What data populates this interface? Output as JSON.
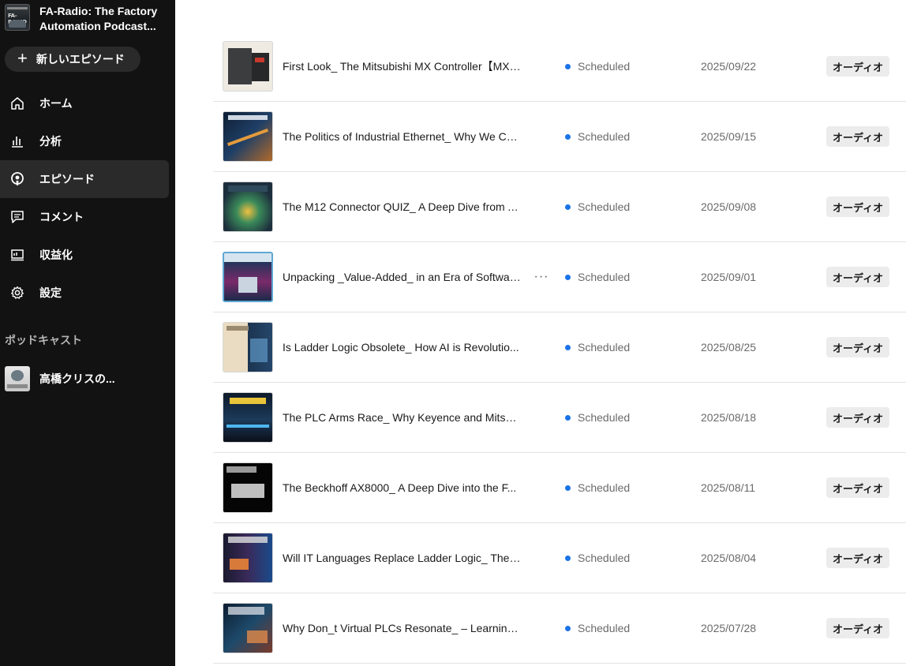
{
  "sidebar": {
    "podcast_title": "FA-Radio: The Factory Automation Podcast...",
    "podcast_thumb_text": "FA-RADIO",
    "new_episode_label": "新しいエピソード",
    "nav": [
      {
        "label": "ホーム",
        "icon": "home-icon"
      },
      {
        "label": "分析",
        "icon": "bar-chart-icon"
      },
      {
        "label": "エピソード",
        "icon": "podcast-mic-icon",
        "active": true
      },
      {
        "label": "コメント",
        "icon": "comment-icon"
      },
      {
        "label": "収益化",
        "icon": "monetize-icon"
      },
      {
        "label": "設定",
        "icon": "gear-icon"
      }
    ],
    "section_label": "ポッドキャスト",
    "podcast_item_label": "高橋クリスの..."
  },
  "episodes": [
    {
      "title": "First Look_ The Mitsubishi MX Controller【MX-...",
      "status": "Scheduled",
      "date": "2025/09/22",
      "type": "オーディオ"
    },
    {
      "title": "The Politics of Industrial Ethernet_ Why We Ca...",
      "status": "Scheduled",
      "date": "2025/09/15",
      "type": "オーディオ"
    },
    {
      "title": "The M12 Connector QUIZ_ A Deep Dive from A...",
      "status": "Scheduled",
      "date": "2025/09/08",
      "type": "オーディオ"
    },
    {
      "title": "Unpacking _Value-Added_ in an Era of Softwar...",
      "status": "Scheduled",
      "date": "2025/09/01",
      "type": "オーディオ",
      "hover": true,
      "more_label": "···"
    },
    {
      "title": "Is Ladder Logic Obsolete_ How AI is Revolutio...",
      "status": "Scheduled",
      "date": "2025/08/25",
      "type": "オーディオ"
    },
    {
      "title": "The PLC Arms Race_ Why Keyence and Mitsubi...",
      "status": "Scheduled",
      "date": "2025/08/18",
      "type": "オーディオ"
    },
    {
      "title": "The Beckhoff AX8000_ A Deep Dive into the F...",
      "status": "Scheduled",
      "date": "2025/08/11",
      "type": "オーディオ"
    },
    {
      "title": "Will IT Languages Replace Ladder Logic_ The F...",
      "status": "Scheduled",
      "date": "2025/08/04",
      "type": "オーディオ"
    },
    {
      "title": "Why Don_t Virtual PLCs Resonate_ – Learning ...",
      "status": "Scheduled",
      "date": "2025/07/28",
      "type": "オーディオ"
    }
  ],
  "colors": {
    "sidebar_bg": "#121212",
    "status_dot": "#1a73e8",
    "badge_bg": "#ececec"
  }
}
